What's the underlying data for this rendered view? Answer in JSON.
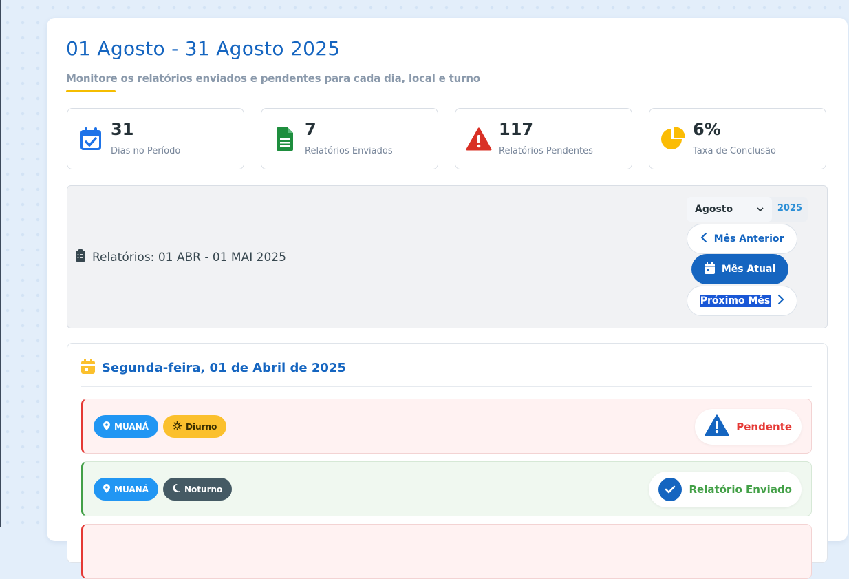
{
  "header": {
    "title": "01 Agosto - 31 Agosto 2025",
    "subtitle": "Monitore os relatórios enviados e pendentes para cada dia, local e turno"
  },
  "stats": [
    {
      "icon": "calendar-check-icon",
      "value": "31",
      "label": "Dias no Período",
      "color": "#1e73e8"
    },
    {
      "icon": "file-spreadsheet-icon",
      "value": "7",
      "label": "Relatórios Enviados",
      "color": "#1e8e3e"
    },
    {
      "icon": "warning-triangle-icon",
      "value": "117",
      "label": "Relatórios Pendentes",
      "color": "#d93025"
    },
    {
      "icon": "pie-chart-icon",
      "value": "6%",
      "label": "Taxa de Conclusão",
      "color": "#fbbc04"
    }
  ],
  "filter": {
    "label": "Relatórios: 01 ABR - 01 MAI 2025",
    "month_select": "Agosto",
    "year": "2025",
    "prev_label": "Mês Anterior",
    "current_label": "Mês Atual",
    "next_label": "Próximo Mês"
  },
  "day": {
    "title": "Segunda-feira, 01 de Abril de 2025",
    "shifts": [
      {
        "location": "MUANÁ",
        "shift": "Diurno",
        "status": "Pendente"
      },
      {
        "location": "MUANÁ",
        "shift": "Noturno",
        "status": "Relatório Enviado"
      }
    ]
  },
  "colors": {
    "accent": "#1565c0",
    "pending": "#e53935",
    "sent": "#43a047",
    "underline": "#f5bd00"
  }
}
